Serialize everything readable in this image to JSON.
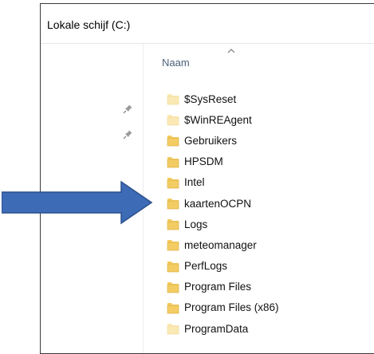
{
  "window": {
    "title": "Lokale schijf (C:)"
  },
  "column": {
    "name_header": "Naam"
  },
  "colors": {
    "folder": "#f3cc63",
    "folder_pale": "#fbe9b5",
    "arrow": "#3e6bb5"
  },
  "files": [
    {
      "name": "$SysReset",
      "style": "pale"
    },
    {
      "name": "$WinREAgent",
      "style": "pale"
    },
    {
      "name": "Gebruikers",
      "style": "normal"
    },
    {
      "name": "HPSDM",
      "style": "normal"
    },
    {
      "name": "Intel",
      "style": "normal"
    },
    {
      "name": "kaartenOCPN",
      "style": "normal"
    },
    {
      "name": "Logs",
      "style": "normal"
    },
    {
      "name": "meteomanager",
      "style": "normal"
    },
    {
      "name": "PerfLogs",
      "style": "normal"
    },
    {
      "name": "Program Files",
      "style": "normal"
    },
    {
      "name": "Program Files (x86)",
      "style": "normal"
    },
    {
      "name": "ProgramData",
      "style": "pale"
    }
  ]
}
